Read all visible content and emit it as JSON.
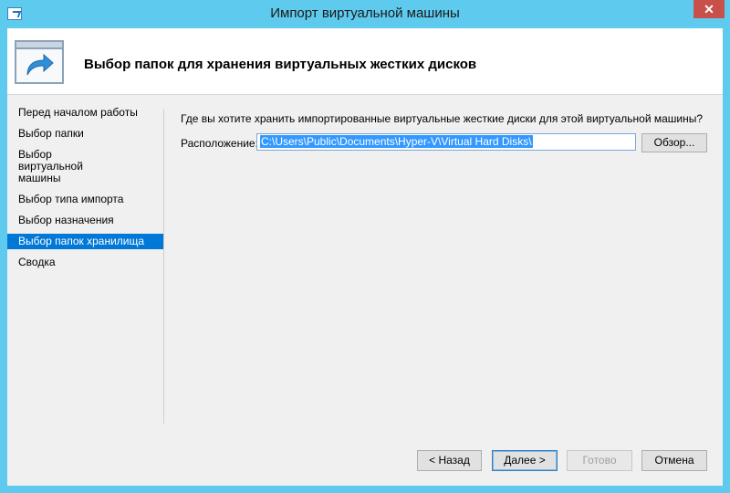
{
  "window": {
    "title": "Импорт виртуальной машины",
    "close_glyph": "✕"
  },
  "header": {
    "title": "Выбор папок для хранения виртуальных жестких дисков",
    "icon": "import-arrow-icon"
  },
  "nav": {
    "items": [
      {
        "label": "Перед началом работы",
        "active": false
      },
      {
        "label": "Выбор папки",
        "active": false
      },
      {
        "label": "Выбор виртуальной машины",
        "active": false
      },
      {
        "label": "Выбор типа импорта",
        "active": false
      },
      {
        "label": "Выбор назначения",
        "active": false
      },
      {
        "label": "Выбор папок хранилища",
        "active": true
      },
      {
        "label": "Сводка",
        "active": false
      }
    ]
  },
  "content": {
    "question": "Где вы хотите хранить импортированные виртуальные жесткие диски для этой виртуальной машины?",
    "location_label": "Расположение:",
    "location_value": "C:\\Users\\Public\\Documents\\Hyper-V\\Virtual Hard Disks\\",
    "browse_label": "Обзор..."
  },
  "buttons": {
    "back": "< Назад",
    "next": "Далее >",
    "finish": "Готово",
    "cancel": "Отмена"
  },
  "colors": {
    "titlebar": "#5ecbee",
    "accent": "#0078d7",
    "close": "#c7504a"
  }
}
